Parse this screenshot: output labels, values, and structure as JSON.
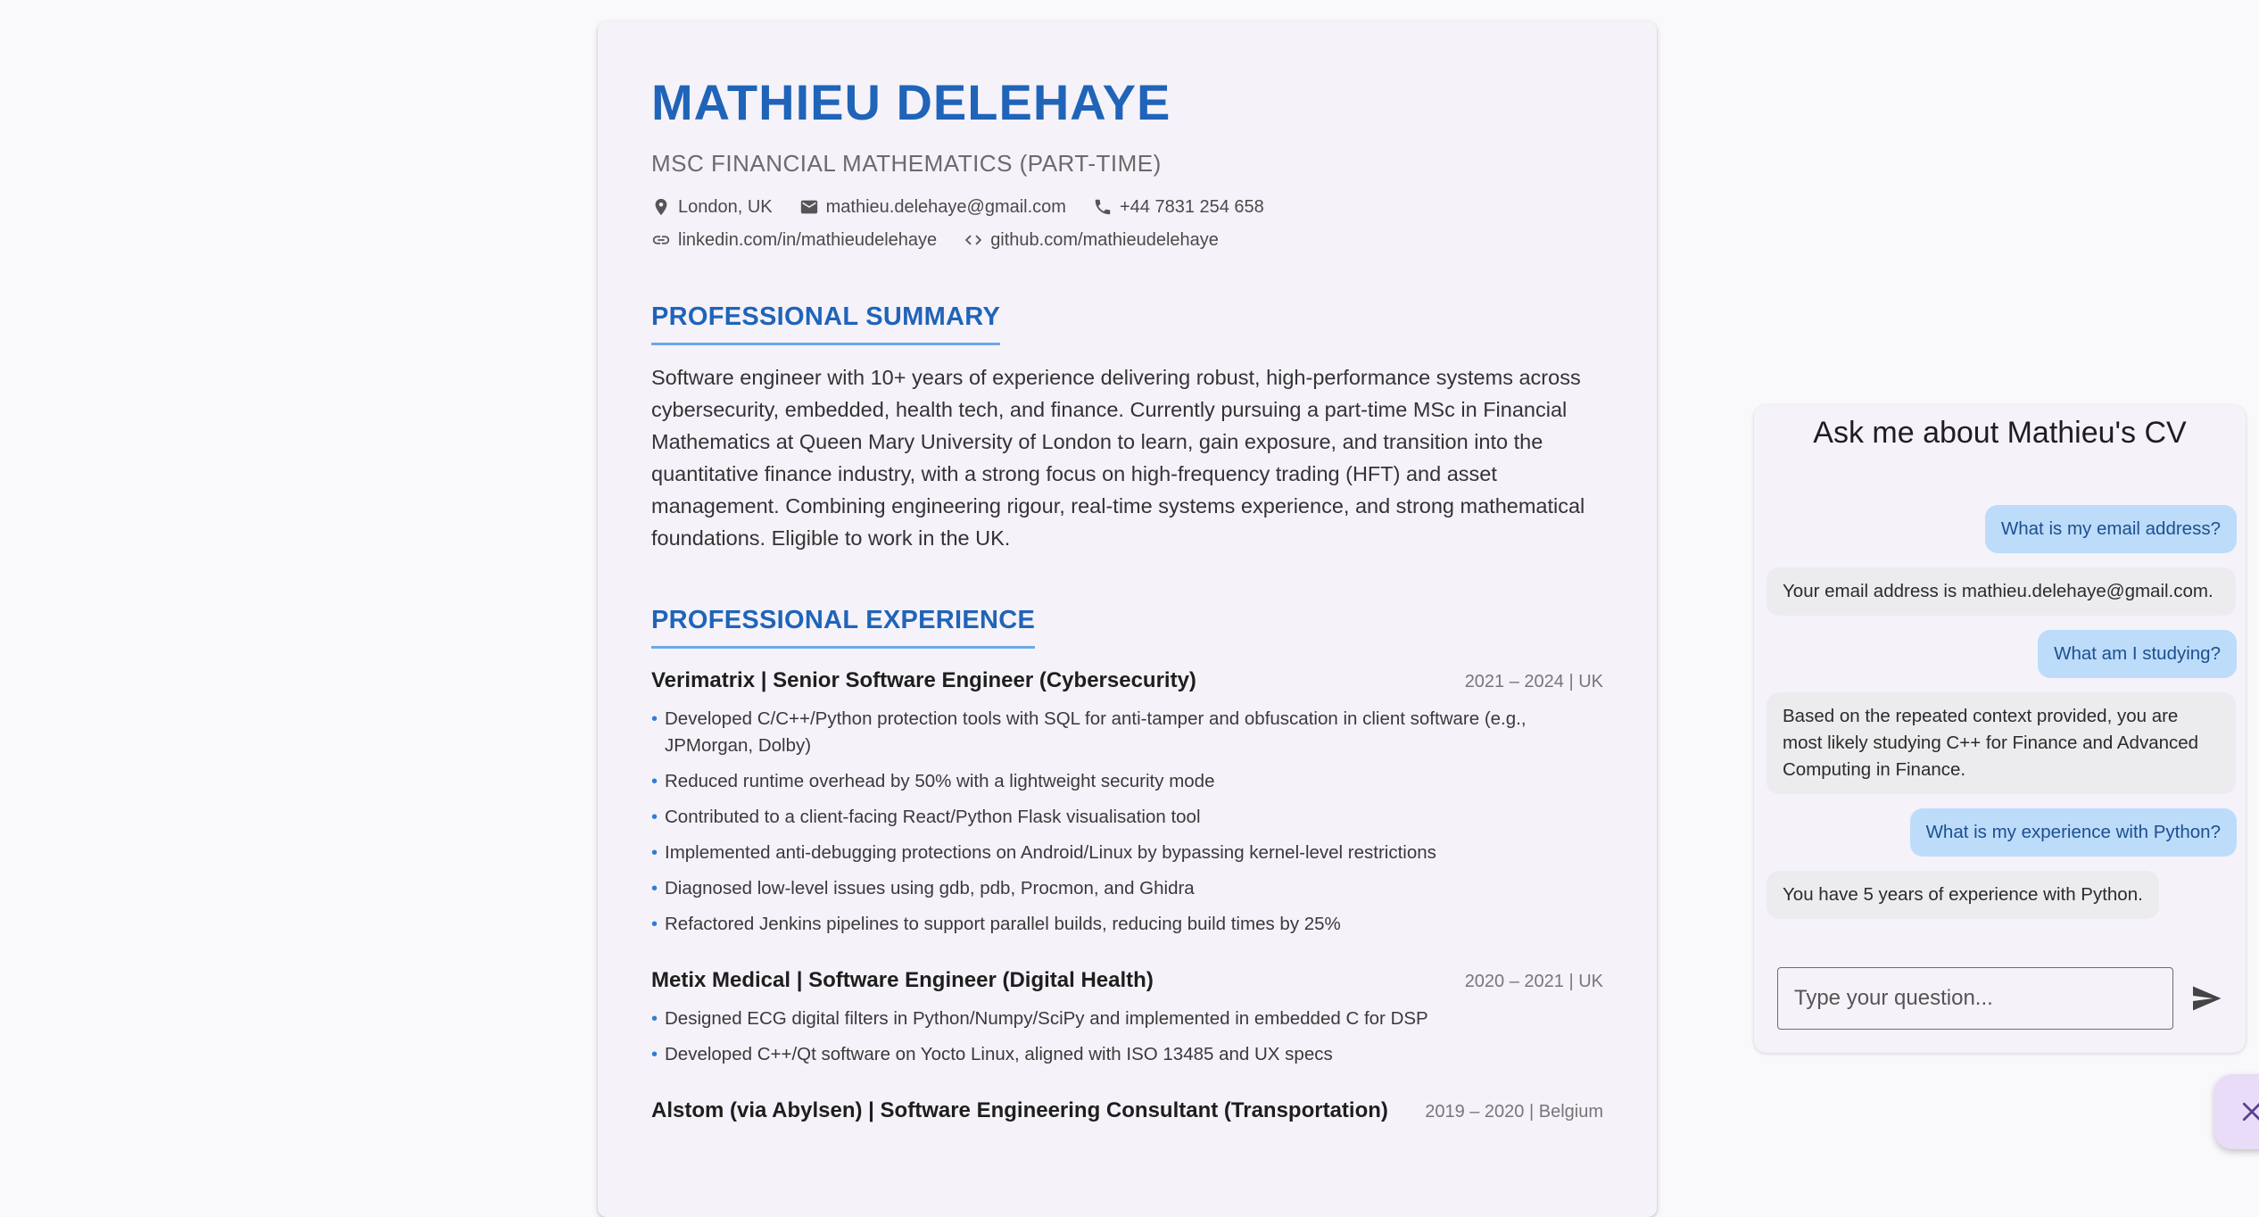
{
  "cv": {
    "name": "MATHIEU DELEHAYE",
    "subtitle": "MSC FINANCIAL MATHEMATICS (PART-TIME)",
    "contact": {
      "location": "London, UK",
      "email": "mathieu.delehaye@gmail.com",
      "phone": "+44 7831 254 658",
      "linkedin": "linkedin.com/in/mathieudelehaye",
      "github": "github.com/mathieudelehaye"
    },
    "summary_heading": "PROFESSIONAL SUMMARY",
    "summary": "Software engineer with 10+ years of experience delivering robust, high-performance systems across cybersecurity, embedded, health tech, and finance. Currently pursuing a part-time MSc in Financial Mathematics at Queen Mary University of London to learn, gain exposure, and transition into the quantitative finance industry, with a strong focus on high-frequency trading (HFT) and asset management. Combining engineering rigour, real-time systems experience, and strong mathematical foundations. Eligible to work in the UK.",
    "experience_heading": "PROFESSIONAL EXPERIENCE",
    "jobs": [
      {
        "title": "Verimatrix | Senior Software Engineer (Cybersecurity)",
        "meta": "2021 – 2024 | UK",
        "bullets": [
          "Developed C/C++/Python protection tools with SQL for anti-tamper and obfuscation in client software (e.g., JPMorgan, Dolby)",
          "Reduced runtime overhead by 50% with a lightweight security mode",
          "Contributed to a client-facing React/Python Flask visualisation tool",
          "Implemented anti-debugging protections on Android/Linux by bypassing kernel-level restrictions",
          "Diagnosed low-level issues using gdb, pdb, Procmon, and Ghidra",
          "Refactored Jenkins pipelines to support parallel builds, reducing build times by 25%"
        ]
      },
      {
        "title": "Metix Medical | Software Engineer (Digital Health)",
        "meta": "2020 – 2021 | UK",
        "bullets": [
          "Designed ECG digital filters in Python/Numpy/SciPy and implemented in embedded C for DSP",
          "Developed C++/Qt software on Yocto Linux, aligned with ISO 13485 and UX specs"
        ]
      },
      {
        "title": "Alstom (via Abylsen) | Software Engineering Consultant (Transportation)",
        "meta": "2019 – 2020 | Belgium",
        "bullets": []
      }
    ]
  },
  "chat": {
    "title": "Ask me about Mathieu's CV",
    "messages": [
      {
        "role": "user",
        "text": "What is my email address?"
      },
      {
        "role": "bot",
        "text": "Your email address is mathieu.delehaye@gmail.com."
      },
      {
        "role": "user",
        "text": "What am I studying?"
      },
      {
        "role": "bot",
        "text": "Based on the repeated context provided, you are most likely studying C++ for Finance and Advanced Computing in Finance."
      },
      {
        "role": "user",
        "text": "What is my experience with Python?"
      },
      {
        "role": "bot",
        "text": "You have 5 years of experience with Python."
      }
    ],
    "input_placeholder": "Type your question...",
    "input_value": ""
  },
  "icons": {
    "location": "map-pin-icon",
    "email": "mail-icon",
    "phone": "phone-icon",
    "linkedin": "link-icon",
    "github": "code-icon",
    "send": "send-icon",
    "close": "close-icon"
  },
  "colors": {
    "accent": "#1f64b8",
    "user_bubble": "#bcdcfa",
    "bot_bubble": "#ececee",
    "fab": "#e9dcf8"
  }
}
